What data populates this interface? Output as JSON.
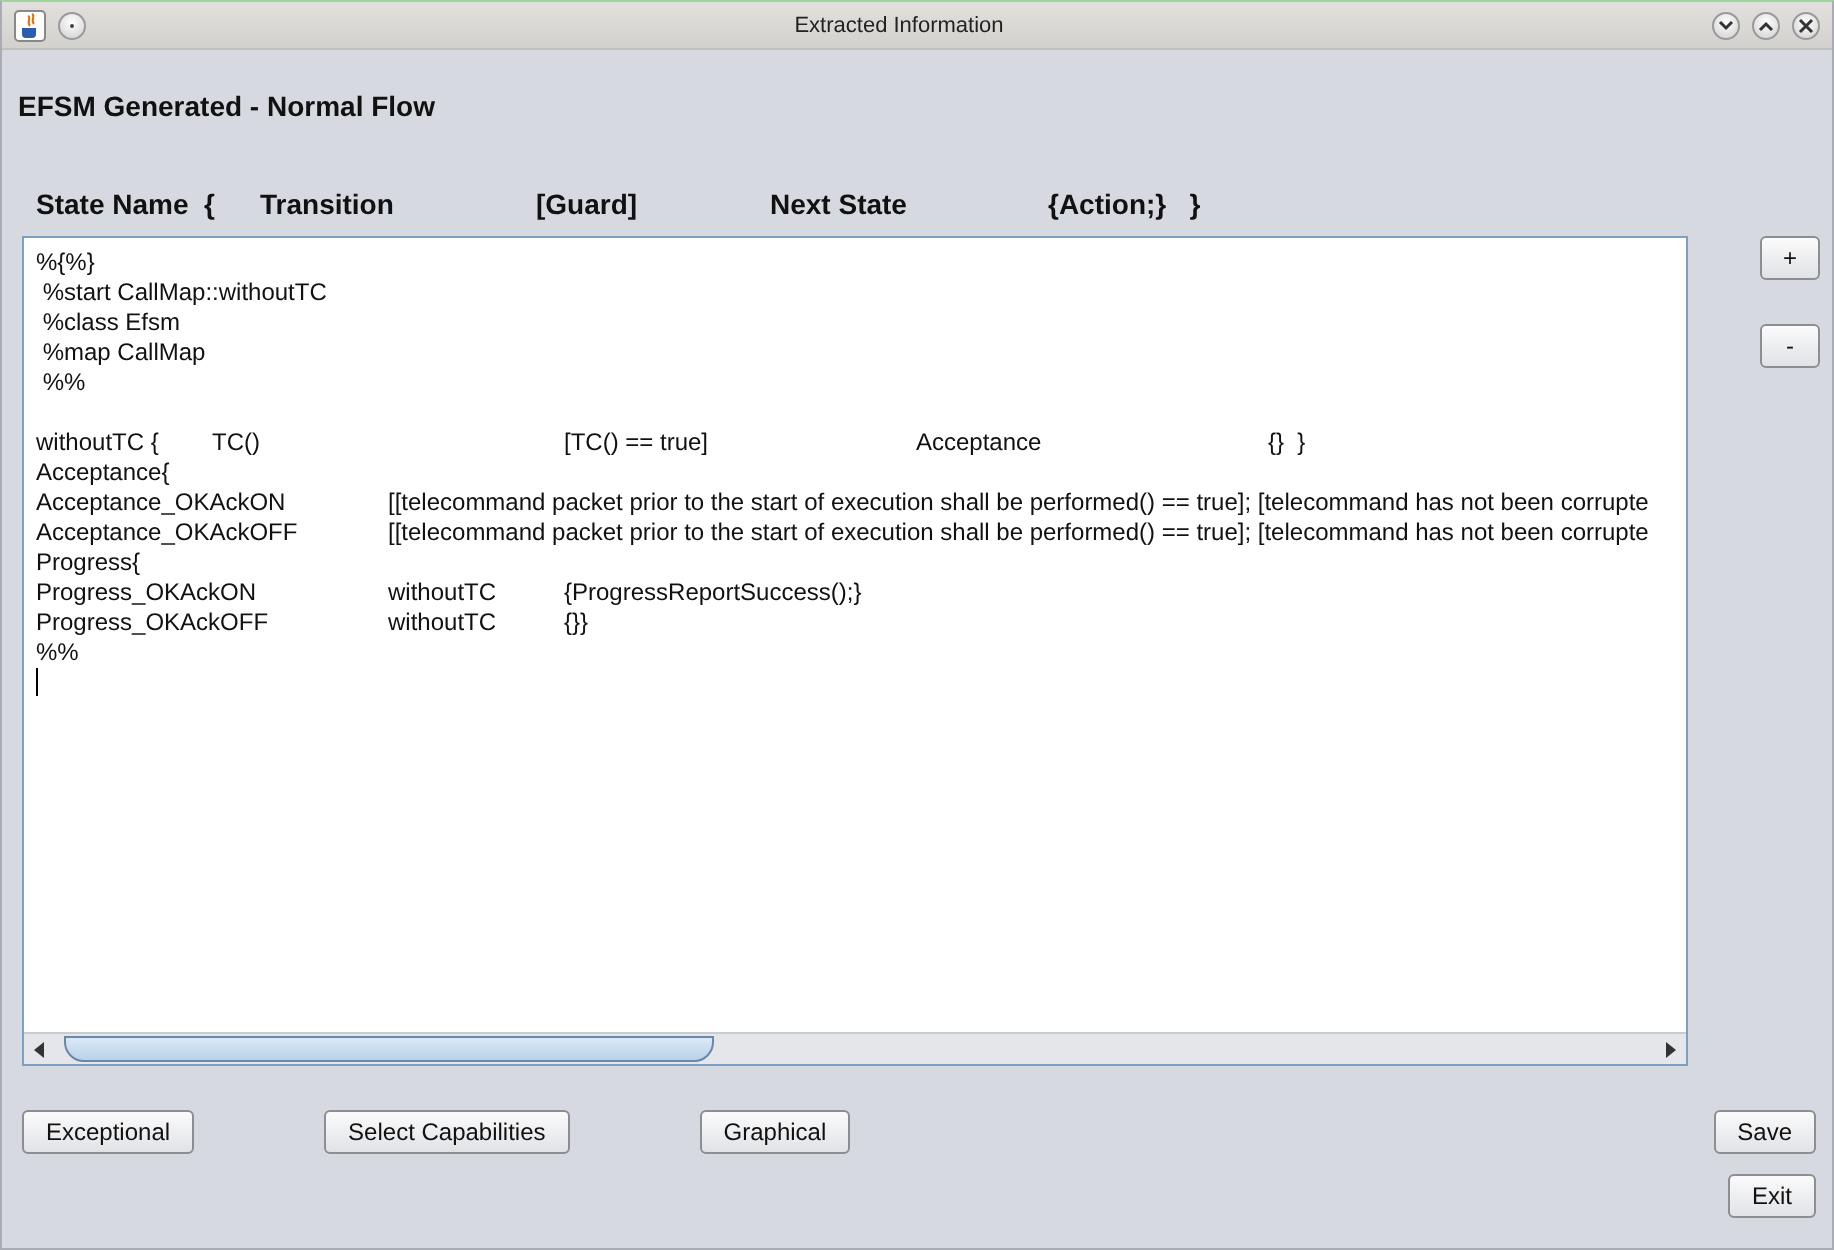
{
  "window": {
    "title": "Extracted Information"
  },
  "heading": "EFSM Generated - Normal Flow",
  "columns": [
    "State Name  {",
    "Transition",
    "[Guard]",
    "Next State",
    "{Action;}   }"
  ],
  "editor": {
    "lines": [
      "%{%}",
      " %start CallMap::withoutTC",
      " %class Efsm",
      " %map CallMap",
      " %%"
    ],
    "body_lines": [
      "withoutTC {\tTC()\t\t[TC() == true]\t\tAcceptance\t\t{}  }",
      "Acceptance{",
      "Acceptance_OKAckON\t[[telecommand packet prior to the start of execution shall be performed() == true]; [telecommand has not been corrupte",
      "Acceptance_OKAckOFF\t[[telecommand packet prior to the start of execution shall be performed() == true]; [telecommand has not been corrupte",
      "Progress{",
      "Progress_OKAckON\twithoutTC\t{ProgressReportSuccess();}",
      "Progress_OKAckOFF\twithoutTC\t{}}",
      "%%"
    ]
  },
  "side_buttons": [
    "+",
    "-"
  ],
  "buttons": [
    "Exceptional",
    "Select Capabilities",
    "Graphical"
  ],
  "right_buttons": [
    "Save",
    "Exit"
  ]
}
